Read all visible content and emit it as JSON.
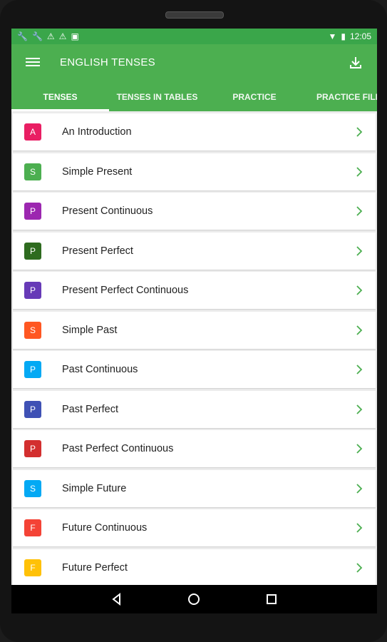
{
  "status": {
    "time": "12:05"
  },
  "app": {
    "title": "ENGLISH TENSES"
  },
  "tabs": [
    {
      "label": "TENSES"
    },
    {
      "label": "TENSES IN TABLES"
    },
    {
      "label": "PRACTICE"
    },
    {
      "label": "PRACTICE FILL"
    }
  ],
  "items": [
    {
      "letter": "A",
      "label": "An Introduction",
      "color": "#e91e63"
    },
    {
      "letter": "S",
      "label": "Simple Present",
      "color": "#4caf50"
    },
    {
      "letter": "P",
      "label": "Present Continuous",
      "color": "#9c27b0"
    },
    {
      "letter": "P",
      "label": "Present Perfect",
      "color": "#2e6b1f"
    },
    {
      "letter": "P",
      "label": "Present Perfect Continuous",
      "color": "#673ab7"
    },
    {
      "letter": "S",
      "label": "Simple Past",
      "color": "#ff5722"
    },
    {
      "letter": "P",
      "label": "Past Continuous",
      "color": "#03a9f4"
    },
    {
      "letter": "P",
      "label": "Past Perfect",
      "color": "#3f51b5"
    },
    {
      "letter": "P",
      "label": "Past Perfect Continuous",
      "color": "#d32f2f"
    },
    {
      "letter": "S",
      "label": "Simple Future",
      "color": "#03a9f4"
    },
    {
      "letter": "F",
      "label": "Future Continuous",
      "color": "#f44336"
    },
    {
      "letter": "F",
      "label": "Future Perfect",
      "color": "#ffc107"
    }
  ],
  "colors": {
    "appbar": "#4caf50",
    "statusbar": "#3aa64a",
    "chevron": "#4caf50"
  }
}
